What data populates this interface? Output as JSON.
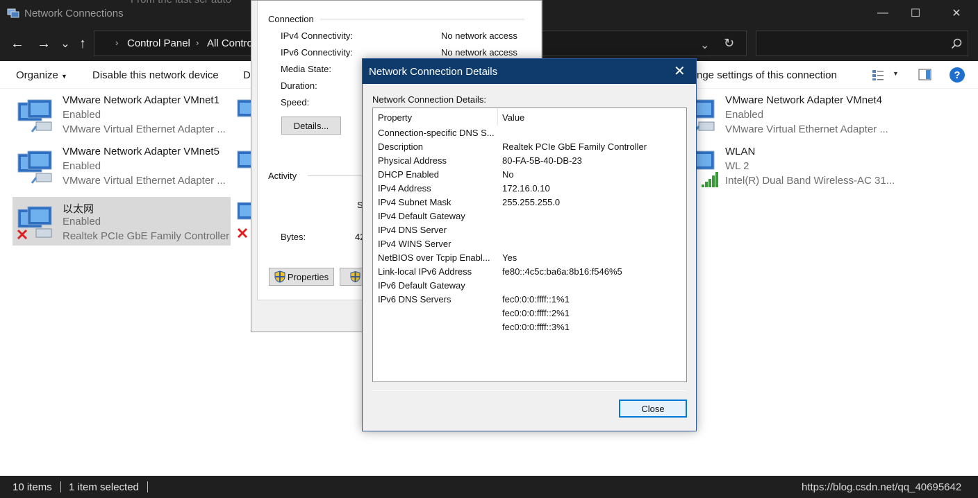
{
  "window": {
    "title": "Network Connections",
    "ghost_title": "From the last scr auto",
    "controls": {
      "minimize": "—",
      "maximize": "☐",
      "close": "✕"
    }
  },
  "nav": {
    "back": "←",
    "forward": "→",
    "recent": "⌄",
    "up": "↑",
    "breadcrumbs": [
      "Control Panel",
      "All Contro"
    ],
    "refresh": "↻",
    "search_icon": "⌕"
  },
  "commands": {
    "organize": "Organize",
    "disable": "Disable this network device",
    "truncated": "D",
    "change_settings": "nge settings of this connection",
    "help": "?"
  },
  "adapters": [
    {
      "name": "VMware Network Adapter VMnet1",
      "status": "Enabled",
      "device": "VMware Virtual Ethernet Adapter ..."
    },
    {
      "name": "VMware Network Adapter VMnet5",
      "status": "Enabled",
      "device": "VMware Virtual Ethernet Adapter ..."
    },
    {
      "name": "以太网",
      "status": "Enabled",
      "device": "Realtek PCIe GbE Family Controller"
    },
    {
      "name": "VMware Network Adapter VMnet4",
      "status": "Enabled",
      "device": "VMware Virtual Ethernet Adapter ..."
    },
    {
      "name": "WLAN",
      "status": "WL 2",
      "device": "Intel(R) Dual Band Wireless-AC 31..."
    }
  ],
  "status_dialog": {
    "connection_label": "Connection",
    "ipv4_label": "IPv4 Connectivity:",
    "ipv4_value": "No network access",
    "ipv6_label": "IPv6 Connectivity:",
    "ipv6_value": "No network access",
    "media_label": "Media State:",
    "duration_label": "Duration:",
    "speed_label": "Speed:",
    "details_button": "Details...",
    "activity_label": "Activity",
    "sent_fragment": "S",
    "bytes_label": "Bytes:",
    "bytes_fragment": "42",
    "properties_button": "Properties"
  },
  "details_dialog": {
    "title": "Network Connection Details",
    "close_x": "✕",
    "caption": "Network Connection Details:",
    "col_property": "Property",
    "col_value": "Value",
    "rows": [
      {
        "property": "Connection-specific DNS S...",
        "value": ""
      },
      {
        "property": "Description",
        "value": "Realtek PCIe GbE Family Controller"
      },
      {
        "property": "Physical Address",
        "value": "80-FA-5B-40-DB-23"
      },
      {
        "property": "DHCP Enabled",
        "value": "No"
      },
      {
        "property": "IPv4 Address",
        "value": "172.16.0.10"
      },
      {
        "property": "IPv4 Subnet Mask",
        "value": "255.255.255.0"
      },
      {
        "property": "IPv4 Default Gateway",
        "value": ""
      },
      {
        "property": "IPv4 DNS Server",
        "value": ""
      },
      {
        "property": "IPv4 WINS Server",
        "value": ""
      },
      {
        "property": "NetBIOS over Tcpip Enabl...",
        "value": "Yes"
      },
      {
        "property": "Link-local IPv6 Address",
        "value": "fe80::4c5c:ba6a:8b16:f546%5"
      },
      {
        "property": "IPv6 Default Gateway",
        "value": ""
      },
      {
        "property": "IPv6 DNS Servers",
        "value": "fec0:0:0:ffff::1%1"
      },
      {
        "property": "",
        "value": "fec0:0:0:ffff::2%1"
      },
      {
        "property": "",
        "value": "fec0:0:0:ffff::3%1"
      }
    ],
    "close_button": "Close"
  },
  "statusbar": {
    "count": "10 items",
    "selected": "1 item selected",
    "watermark": "https://blog.csdn.net/qq_40695642"
  }
}
